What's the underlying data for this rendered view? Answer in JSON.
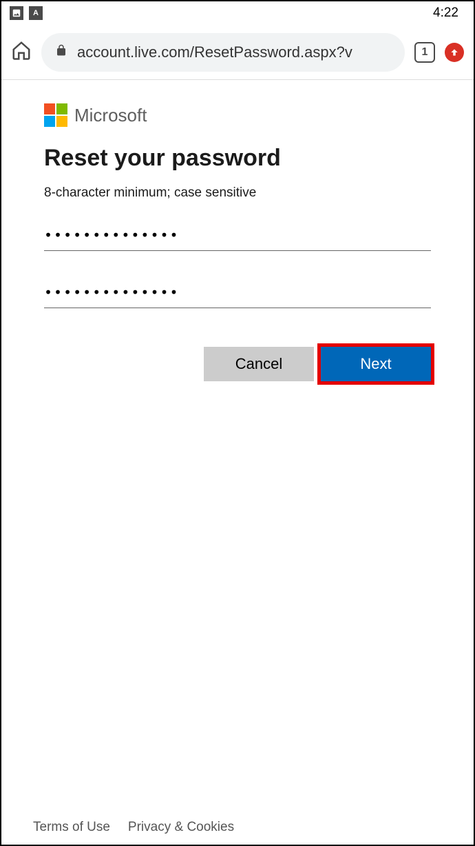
{
  "status_bar": {
    "time": "4:22"
  },
  "browser": {
    "url": "account.live.com/ResetPassword.aspx?v",
    "tab_count": "1"
  },
  "logo": {
    "brand": "Microsoft"
  },
  "page": {
    "title": "Reset your password",
    "hint": "8-character minimum; case sensitive"
  },
  "form": {
    "password_value": "••••••••••••••",
    "confirm_value": "••••••••••••••",
    "cancel_label": "Cancel",
    "next_label": "Next"
  },
  "footer": {
    "terms": "Terms of Use",
    "privacy": "Privacy & Cookies"
  }
}
